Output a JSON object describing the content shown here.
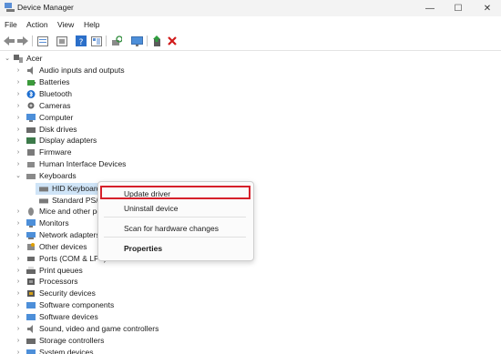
{
  "window": {
    "title": "Device Manager",
    "minimize_glyph": "—",
    "maximize_glyph": "☐",
    "close_glyph": "✕"
  },
  "menu": [
    "File",
    "Action",
    "View",
    "Help"
  ],
  "toolbar": {
    "icons": [
      "back-icon",
      "forward-icon",
      "properties-icon",
      "show-hidden-icon",
      "help-icon",
      "view-icon",
      "scan-hardware-icon",
      "monitor-icon",
      "update-driver-icon",
      "uninstall-icon"
    ]
  },
  "tree": {
    "root": "Acer",
    "categories": [
      {
        "label": "Audio inputs and outputs",
        "icon": "speaker-icon"
      },
      {
        "label": "Batteries",
        "icon": "battery-icon"
      },
      {
        "label": "Bluetooth",
        "icon": "bluetooth-icon"
      },
      {
        "label": "Cameras",
        "icon": "camera-icon"
      },
      {
        "label": "Computer",
        "icon": "computer-icon"
      },
      {
        "label": "Disk drives",
        "icon": "disk-icon"
      },
      {
        "label": "Display adapters",
        "icon": "display-adapter-icon"
      },
      {
        "label": "Firmware",
        "icon": "firmware-icon"
      },
      {
        "label": "Human Interface Devices",
        "icon": "hid-icon"
      },
      {
        "label": "Keyboards",
        "icon": "keyboard-icon"
      }
    ],
    "keyboard_children": [
      "HID Keyboard",
      "Standard PS/2"
    ],
    "categories_after": [
      {
        "label": "Mice and other po",
        "icon": "mouse-icon"
      },
      {
        "label": "Monitors",
        "icon": "monitor-icon"
      },
      {
        "label": "Network adapters",
        "icon": "network-icon"
      },
      {
        "label": "Other devices",
        "icon": "other-devices-icon"
      },
      {
        "label": "Ports (COM & LPT)",
        "icon": "port-icon"
      },
      {
        "label": "Print queues",
        "icon": "printer-icon"
      },
      {
        "label": "Processors",
        "icon": "processor-icon"
      },
      {
        "label": "Security devices",
        "icon": "security-icon"
      },
      {
        "label": "Software components",
        "icon": "software-icon"
      },
      {
        "label": "Software devices",
        "icon": "software-icon"
      },
      {
        "label": "Sound, video and game controllers",
        "icon": "sound-icon"
      },
      {
        "label": "Storage controllers",
        "icon": "storage-icon"
      },
      {
        "label": "System devices",
        "icon": "system-icon"
      }
    ]
  },
  "context_menu": {
    "update": "Update driver",
    "uninstall": "Uninstall device",
    "scan": "Scan for hardware changes",
    "properties": "Properties"
  },
  "colors": {
    "highlight_border": "#d6202a",
    "selection": "#cfe4f7"
  }
}
